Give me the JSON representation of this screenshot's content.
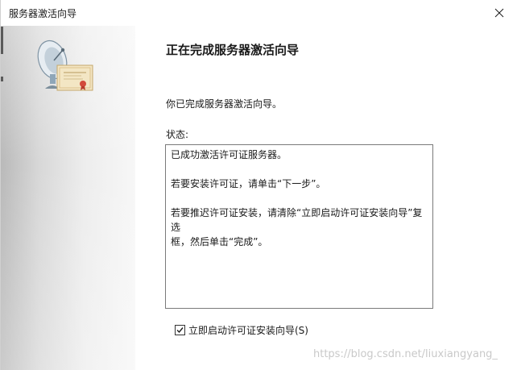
{
  "window": {
    "title": "服务器激活向导",
    "close_glyph": "×"
  },
  "main": {
    "heading": "正在完成服务器激活向导",
    "description": "你已完成服务器激活向导。",
    "status_label": "状态:",
    "status_lines": [
      "已成功激活许可证服务器。",
      "若要安装许可证，请单击“下一步”。",
      "若要推迟许可证安装，请清除“立即启动许可证安装向导”复选",
      "框，然后单击“完成”。"
    ],
    "checkbox": {
      "label": "立即启动许可证安装向导(S)",
      "checked": true
    }
  },
  "watermark": "https://blog.csdn.net/liuxiangyang_",
  "icons": {
    "close": "close-icon",
    "wizard": "satellite-certificate-icon",
    "check": "checkmark-icon"
  },
  "colors": {
    "panel_gradient_start": "#b9b9b9",
    "panel_gradient_end": "#f7f7f7",
    "certificate": "#f3e6c4",
    "dish": "#8fa6b8"
  }
}
